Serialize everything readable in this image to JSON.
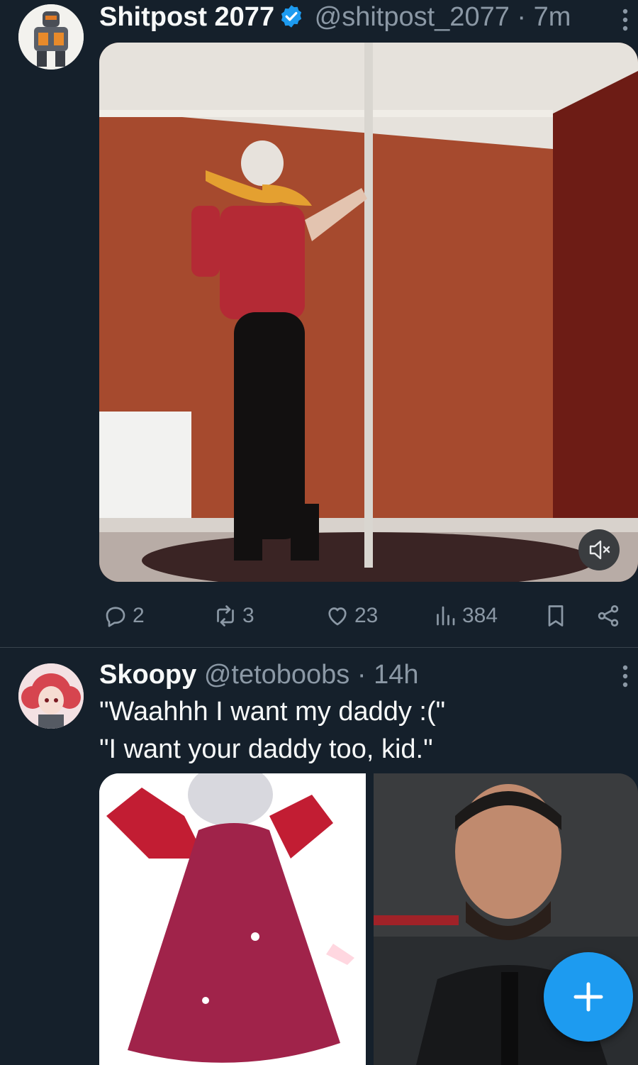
{
  "tweets": [
    {
      "name": "Shitpost 2077",
      "handle": "@shitpost_2077",
      "time": "· 7m",
      "stats": {
        "replies": "2",
        "reposts": "3",
        "likes": "23",
        "views": "384"
      }
    },
    {
      "name": "Skoopy",
      "handle": "@tetoboobs",
      "time": "· 14h",
      "text_line1": "\"Waahhh I want my daddy :(\"",
      "text_line2": "\"I want your daddy too, kid.\""
    }
  ],
  "colors": {
    "background": "#15202b",
    "text": "#f7f9f9",
    "secondary_text": "#8b98a5",
    "accent": "#1d9bf0",
    "divider": "#38444d"
  },
  "icons": [
    "verified-badge-icon",
    "more-options-icon",
    "mute-icon",
    "reply-icon",
    "repost-icon",
    "like-icon",
    "views-icon",
    "bookmark-icon",
    "share-icon",
    "compose-icon"
  ]
}
